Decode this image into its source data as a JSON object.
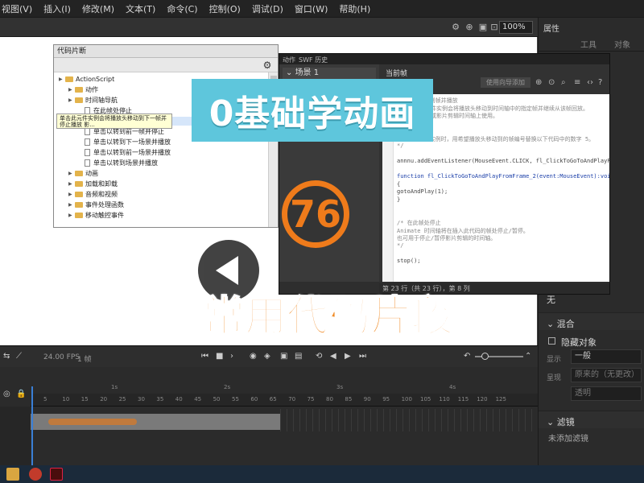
{
  "menu": {
    "items": [
      "视图(V)",
      "插入(I)",
      "修改(M)",
      "文本(T)",
      "命令(C)",
      "控制(O)",
      "调试(D)",
      "窗口(W)",
      "帮助(H)"
    ]
  },
  "toolbar": {
    "zoom": "100%"
  },
  "properties_panel": {
    "title": "属性",
    "tabs": [
      "工具",
      "对象"
    ],
    "blend_value": "无",
    "blend_section": "混合",
    "hide_object_label": "隐藏对象",
    "mode_label": "显示",
    "mode_value": "一般",
    "render_label": "呈现",
    "render_value": "原来的（无更改）",
    "transparent": "透明",
    "filter_section": "滤镜",
    "filter_none": "未添加滤镜"
  },
  "snippets_panel": {
    "title": "代码片断",
    "tree": [
      {
        "label": "ActionScript",
        "kind": "folder",
        "level": 0
      },
      {
        "label": "动作",
        "kind": "folder",
        "level": 1
      },
      {
        "label": "时间轴导航",
        "kind": "folder",
        "level": 1
      },
      {
        "label": "在此帧处停止",
        "kind": "file",
        "level": 2
      },
      {
        "label": "单击以转到下一帧并停止",
        "kind": "file",
        "level": 2,
        "selected": true
      },
      {
        "label": "单击以转到前一帧并停止",
        "kind": "file",
        "level": 2
      },
      {
        "label": "单击以转到下一场景并播放",
        "kind": "file",
        "level": 2
      },
      {
        "label": "单击以转到前一场景并播放",
        "kind": "file",
        "level": 2
      },
      {
        "label": "单击以转到场景并播放",
        "kind": "file",
        "level": 2
      },
      {
        "label": "动画",
        "kind": "folder",
        "level": 1
      },
      {
        "label": "加载和卸载",
        "kind": "folder",
        "level": 1
      },
      {
        "label": "音频和视频",
        "kind": "folder",
        "level": 1
      },
      {
        "label": "事件处理函数",
        "kind": "folder",
        "level": 1
      },
      {
        "label": "移动触控事件",
        "kind": "folder",
        "level": 1
      }
    ],
    "tooltip": "单击此元件实例会将播放头移动到下一帧并停止播放 影..."
  },
  "actions_panel": {
    "tabs": [
      "动作",
      "SWF 历史"
    ],
    "scene": "场景 1",
    "current_frame": "当前帧",
    "add_button": "使用向导添加",
    "code_lines": [
      {
        "text": "/* 单击以转到帧并播放",
        "style": "gr"
      },
      {
        "text": "单击指定的元件实例会将播放头移动到时间轴中的指定帧并继续从该帧回放。",
        "style": "gr"
      },
      {
        "text": "可在主时间轴或影片剪辑时间轴上使用。",
        "style": "gr"
      },
      {
        "text": "",
        "style": ""
      },
      {
        "text": "说明:",
        "style": "gr"
      },
      {
        "text": "1. 单击元件实例时，用希望播放头移动到的帧编号替换以下代码中的数字 5。",
        "style": "gr"
      },
      {
        "text": "*/",
        "style": "gr"
      },
      {
        "text": "",
        "style": ""
      },
      {
        "text": "annnu.addEventListener(MouseEvent.CLICK, fl_ClickToGoToAndPlayFromFrame_2);",
        "style": ""
      },
      {
        "text": "",
        "style": ""
      },
      {
        "text": "function fl_ClickToGoToAndPlayFromFrame_2(event:MouseEvent):void",
        "style": "kw"
      },
      {
        "text": "{",
        "style": ""
      },
      {
        "text": "    gotoAndPlay(1);",
        "style": ""
      },
      {
        "text": "}",
        "style": ""
      },
      {
        "text": "",
        "style": ""
      },
      {
        "text": "",
        "style": ""
      },
      {
        "text": "/* 在此帧处停止",
        "style": "gr"
      },
      {
        "text": "Animate 时间轴将在插入此代码的帧处停止/暂停。",
        "style": "gr"
      },
      {
        "text": "也可用于停止/暂停影片剪辑的时间轴。",
        "style": "gr"
      },
      {
        "text": "*/",
        "style": "gr"
      },
      {
        "text": "",
        "style": ""
      },
      {
        "text": "stop();",
        "style": ""
      }
    ],
    "status": "第 23 行（共 23 行），第 8 列"
  },
  "overlay": {
    "banner": "0基础学动画",
    "episode": "76",
    "title": "常用代码片段"
  },
  "timeline": {
    "fps": "24.00",
    "fps_unit": "FPS",
    "frame": "1",
    "frame_unit": "帧",
    "ruler_ticks": [
      "1s",
      "2s",
      "3s",
      "4s"
    ],
    "frame_ticks": [
      "5",
      "10",
      "15",
      "20",
      "25",
      "30",
      "35",
      "40",
      "45",
      "50",
      "55",
      "60",
      "65",
      "70",
      "75",
      "80",
      "85",
      "90",
      "95",
      "100",
      "105",
      "110",
      "115",
      "120",
      "125"
    ]
  },
  "colors": {
    "banner_bg": "#5ec6dc",
    "accent_orange": "#ef7b1b",
    "title_orange": "#f08a24"
  }
}
